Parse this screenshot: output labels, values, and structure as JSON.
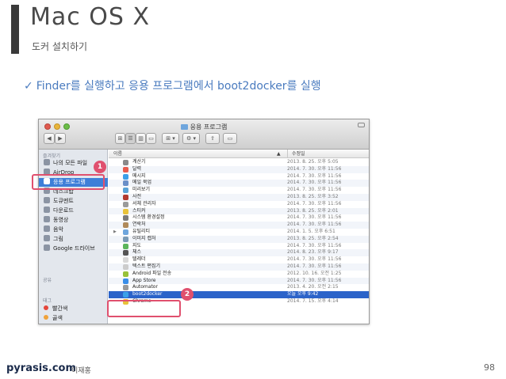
{
  "slide": {
    "title": "Mac OS X",
    "subtitle": "도커 설치하기",
    "bullet_check": "✓",
    "bullet_text": "Finder를 실행하고 응용 프로그램에서 boot2docker를 실행",
    "page_number": "98",
    "footer_brand": "pyrasis.com",
    "footer_author": "이재홍"
  },
  "window": {
    "title": "응용 프로그램",
    "toolbar": {
      "back": "◀",
      "forward": "▶",
      "view_icons": "⊞",
      "view_list": "☰",
      "view_columns": "▥",
      "view_coverflow": "▭",
      "arrange": "⊞ ▾",
      "action": "⚙ ▾",
      "share": "⇪",
      "tags": "▭"
    },
    "sidebar": {
      "favorites_header": "즐겨찾기",
      "items": [
        {
          "label": "나의 모든 파일",
          "icon": "all-files-icon"
        },
        {
          "label": "AirDrop",
          "icon": "airdrop-icon"
        },
        {
          "label": "응용 프로그램",
          "icon": "applications-icon"
        },
        {
          "label": "데스크탑",
          "icon": "desktop-icon"
        },
        {
          "label": "도큐멘트",
          "icon": "documents-icon"
        },
        {
          "label": "다운로드",
          "icon": "downloads-icon"
        },
        {
          "label": "동영상",
          "icon": "movies-icon"
        },
        {
          "label": "음악",
          "icon": "music-icon"
        },
        {
          "label": "그림",
          "icon": "pictures-icon"
        },
        {
          "label": "Google 드라이브",
          "icon": "google-drive-icon"
        }
      ],
      "shared_header": "공유",
      "tags_header": "태그",
      "tags": [
        {
          "label": "빨간색",
          "color": "#e4463b"
        },
        {
          "label": "골색",
          "color": "#f0a23a"
        }
      ]
    },
    "list": {
      "col_name": "이름",
      "col_date": "수정일",
      "sort_arrow": "▲",
      "rows": [
        {
          "name": "계산기",
          "date": "2013. 8. 25. 오후 5:05",
          "color": "#8a8a8a"
        },
        {
          "name": "달력",
          "date": "2014. 7. 30. 오후 11:56",
          "color": "#e85b4c"
        },
        {
          "name": "메시지",
          "date": "2014. 7. 30. 오후 11:56",
          "color": "#3aa0e8"
        },
        {
          "name": "메일 북업",
          "date": "2014. 7. 30. 오후 11:56",
          "color": "#6a8fc8"
        },
        {
          "name": "미리보기",
          "date": "2014. 7. 30. 오후 11:56",
          "color": "#5aa3d6"
        },
        {
          "name": "사전",
          "date": "2013. 8. 25. 오후 3:52",
          "color": "#b23a2e"
        },
        {
          "name": "서체 관리자",
          "date": "2014. 7. 30. 오후 11:56",
          "color": "#9a9a9a"
        },
        {
          "name": "스티커",
          "date": "2013. 8. 25. 오후 2:01",
          "color": "#e8c23a"
        },
        {
          "name": "시스템 환경설정",
          "date": "2014. 7. 30. 오후 11:56",
          "color": "#7a7a7a"
        },
        {
          "name": "연락처",
          "date": "2014. 7. 30. 오후 11:56",
          "color": "#b08a5a"
        },
        {
          "name": "유틸리티",
          "date": "2014. 1. 5. 오후 6:51",
          "color": "#6fa6dd",
          "folder": true
        },
        {
          "name": "이미지 캡처",
          "date": "2013. 8. 25. 오후 2:54",
          "color": "#7a9ab5"
        },
        {
          "name": "지도",
          "date": "2014. 7. 30. 오후 11:56",
          "color": "#5bb55b"
        },
        {
          "name": "체스",
          "date": "2014. 8. 23. 오후 9:17",
          "color": "#555555"
        },
        {
          "name": "텔레더",
          "date": "2014. 7. 30. 오후 11:56",
          "color": "#d8d8d8"
        },
        {
          "name": "텍스트 편집기",
          "date": "2014. 7. 30. 오후 11:56",
          "color": "#cccccc"
        },
        {
          "name": "Android 파일 전송",
          "date": "2012. 10. 16. 오전 1:25",
          "color": "#98c23a"
        },
        {
          "name": "App Store",
          "date": "2014. 7. 30. 오후 11:56",
          "color": "#3a8ee8"
        },
        {
          "name": "Automator",
          "date": "2013. 4. 20. 오전 2:15",
          "color": "#9a9a9a"
        },
        {
          "name": "boot2docker",
          "date": "오늘 오후 9:42",
          "color": "#3aa0e8",
          "selected": true
        },
        {
          "name": "Chrome",
          "date": "2014. 7. 15. 오후 4:14",
          "color": "#e8c23a"
        }
      ]
    }
  },
  "annotations": {
    "badge_1": "1",
    "badge_2": "2",
    "color": "#e0506e"
  }
}
